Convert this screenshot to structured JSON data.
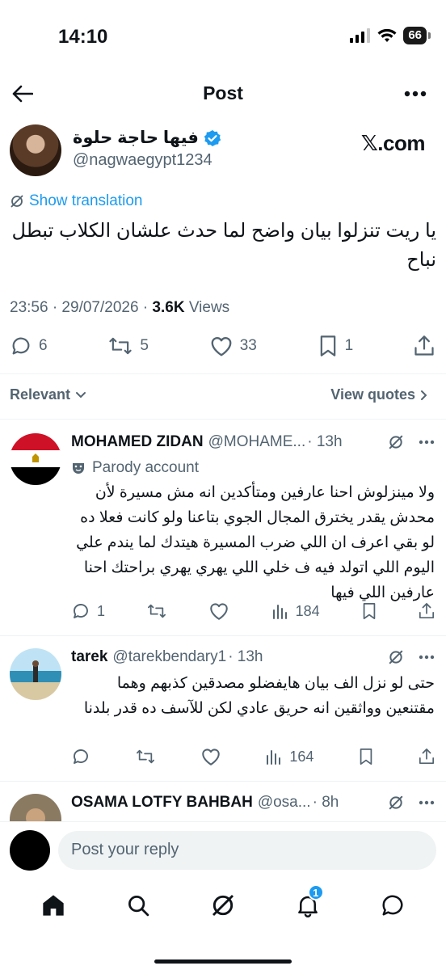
{
  "status_bar": {
    "time": "14:10",
    "battery": "66"
  },
  "header": {
    "title": "Post"
  },
  "main_tweet": {
    "author_name": "فيها حاجة حلوة",
    "author_handle": "@nagwaegypt1234",
    "source_label": "𝕏.com",
    "translation_label": "Show translation",
    "text": "يا ريت تنزلوا بيان واضح لما حدث علشان الكلاب تبطل نباح",
    "timestamp": "23:56 · 29/07/2026 · ",
    "views_count": "3.6K",
    "views_label": " Views",
    "replies": "6",
    "reposts": "5",
    "likes": "33",
    "bookmarks": "1"
  },
  "sort": {
    "relevant_label": "Relevant",
    "view_quotes_label": "View quotes"
  },
  "replies": [
    {
      "name": "MOHAMED ZIDAN",
      "handle": "@MOHAME...",
      "time": "· 13h",
      "badge": "Parody account",
      "text": "ولا مينزلوش احنا عارفين ومتأكدين انه مش مسيرة لأن محدش يقدر يخترق المجال الجوي بتاعنا ولو كانت فعلا ده لو بقي اعرف ان اللي ضرب المسيرة هيتدك لما يندم علي اليوم اللي اتولد فيه ف خلي اللي يهري يهري براحتك احنا عارفين اللي فيها",
      "replies": "1",
      "reposts": "",
      "likes": "",
      "views": "184"
    },
    {
      "name": "tarek",
      "handle": "@tarekbendary1",
      "time": "· 13h",
      "text": "حتى لو نزل الف بيان هايفضلو مصدقين كذبهم وهما مقتنعين وواثقين انه حريق عادي لكن للآسف ده قدر بلدنا",
      "replies": "",
      "reposts": "",
      "likes": "",
      "views": "164"
    },
    {
      "name": "OSAMA LOTFY BAHBAH",
      "handle": "@osa...",
      "time": "· 8h"
    }
  ],
  "composer": {
    "placeholder": "Post your reply"
  },
  "nav": {
    "notifications_badge": "1"
  }
}
